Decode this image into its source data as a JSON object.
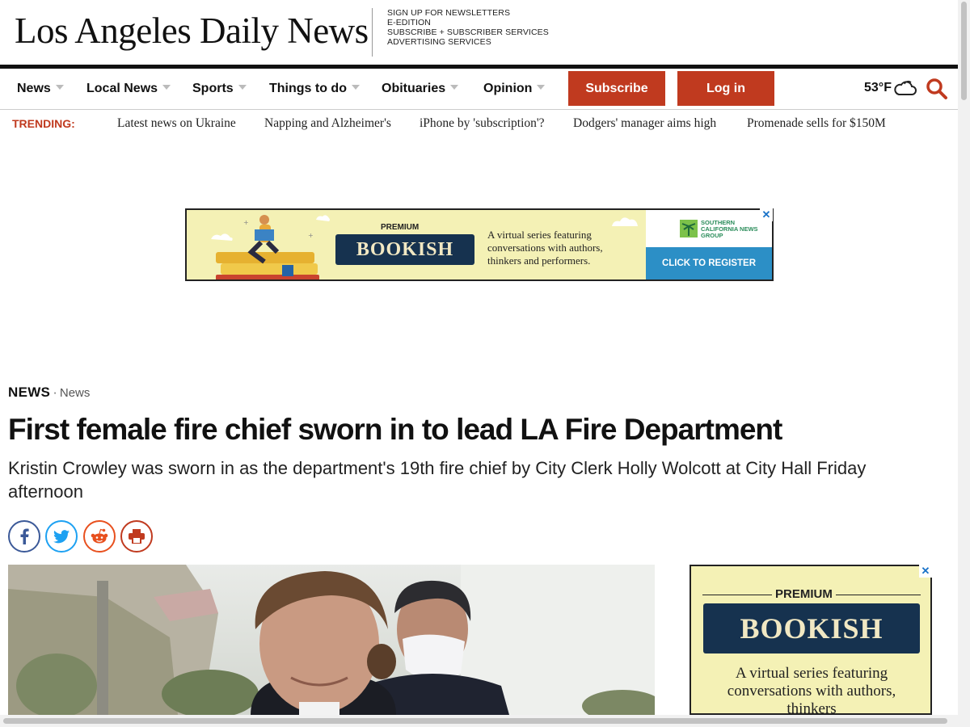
{
  "masthead": {
    "logo": "Los Angeles Daily News",
    "links": [
      "SIGN UP FOR NEWSLETTERS",
      "E-EDITION",
      "SUBSCRIBE + SUBSCRIBER SERVICES",
      "ADVERTISING SERVICES"
    ]
  },
  "nav": {
    "items": [
      "News",
      "Local News",
      "Sports",
      "Things to do",
      "Obituaries",
      "Opinion"
    ],
    "subscribe_label": "Subscribe",
    "login_label": "Log in",
    "weather": "53°F",
    "weather_icon": "cloud-icon",
    "search_icon": "search-icon"
  },
  "trending": {
    "label": "TRENDING:",
    "links": [
      "Latest news on Ukraine",
      "Napping and Alzheimer's",
      "iPhone by 'subscription'?",
      "Dodgers' manager aims high",
      "Promenade sells for $150M"
    ]
  },
  "ad_banner": {
    "premium": "PREMIUM",
    "title": "BOOKISH",
    "copy": "A virtual series featuring conversations with authors, thinkers and performers.",
    "sponsor": "SOUTHERN CALIFORNIA NEWS GROUP",
    "cta": "CLICK TO REGISTER",
    "close": "✕"
  },
  "article": {
    "section": "NEWS",
    "separator": "·",
    "subsection": "News",
    "headline": "First female fire chief sworn in to lead LA Fire Department",
    "dek": "Kristin Crowley was sworn in as the department's 19th fire chief by City Clerk Holly Wolcott at City Hall Friday afternoon"
  },
  "share": [
    {
      "name": "facebook-icon",
      "color": "#3b5998"
    },
    {
      "name": "twitter-icon",
      "color": "#1da1f2"
    },
    {
      "name": "reddit-icon",
      "color": "#e8501e"
    },
    {
      "name": "print-icon",
      "color": "#c03a1f"
    }
  ],
  "side_ad": {
    "premium": "PREMIUM",
    "title": "BOOKISH",
    "copy": "A virtual series featuring conversations with authors, thinkers",
    "close": "✕"
  },
  "colors": {
    "accent": "#c03a1f",
    "ad_background": "#f4f1b5",
    "ad_plate": "#16324f",
    "register_blue": "#2c8fc6"
  }
}
